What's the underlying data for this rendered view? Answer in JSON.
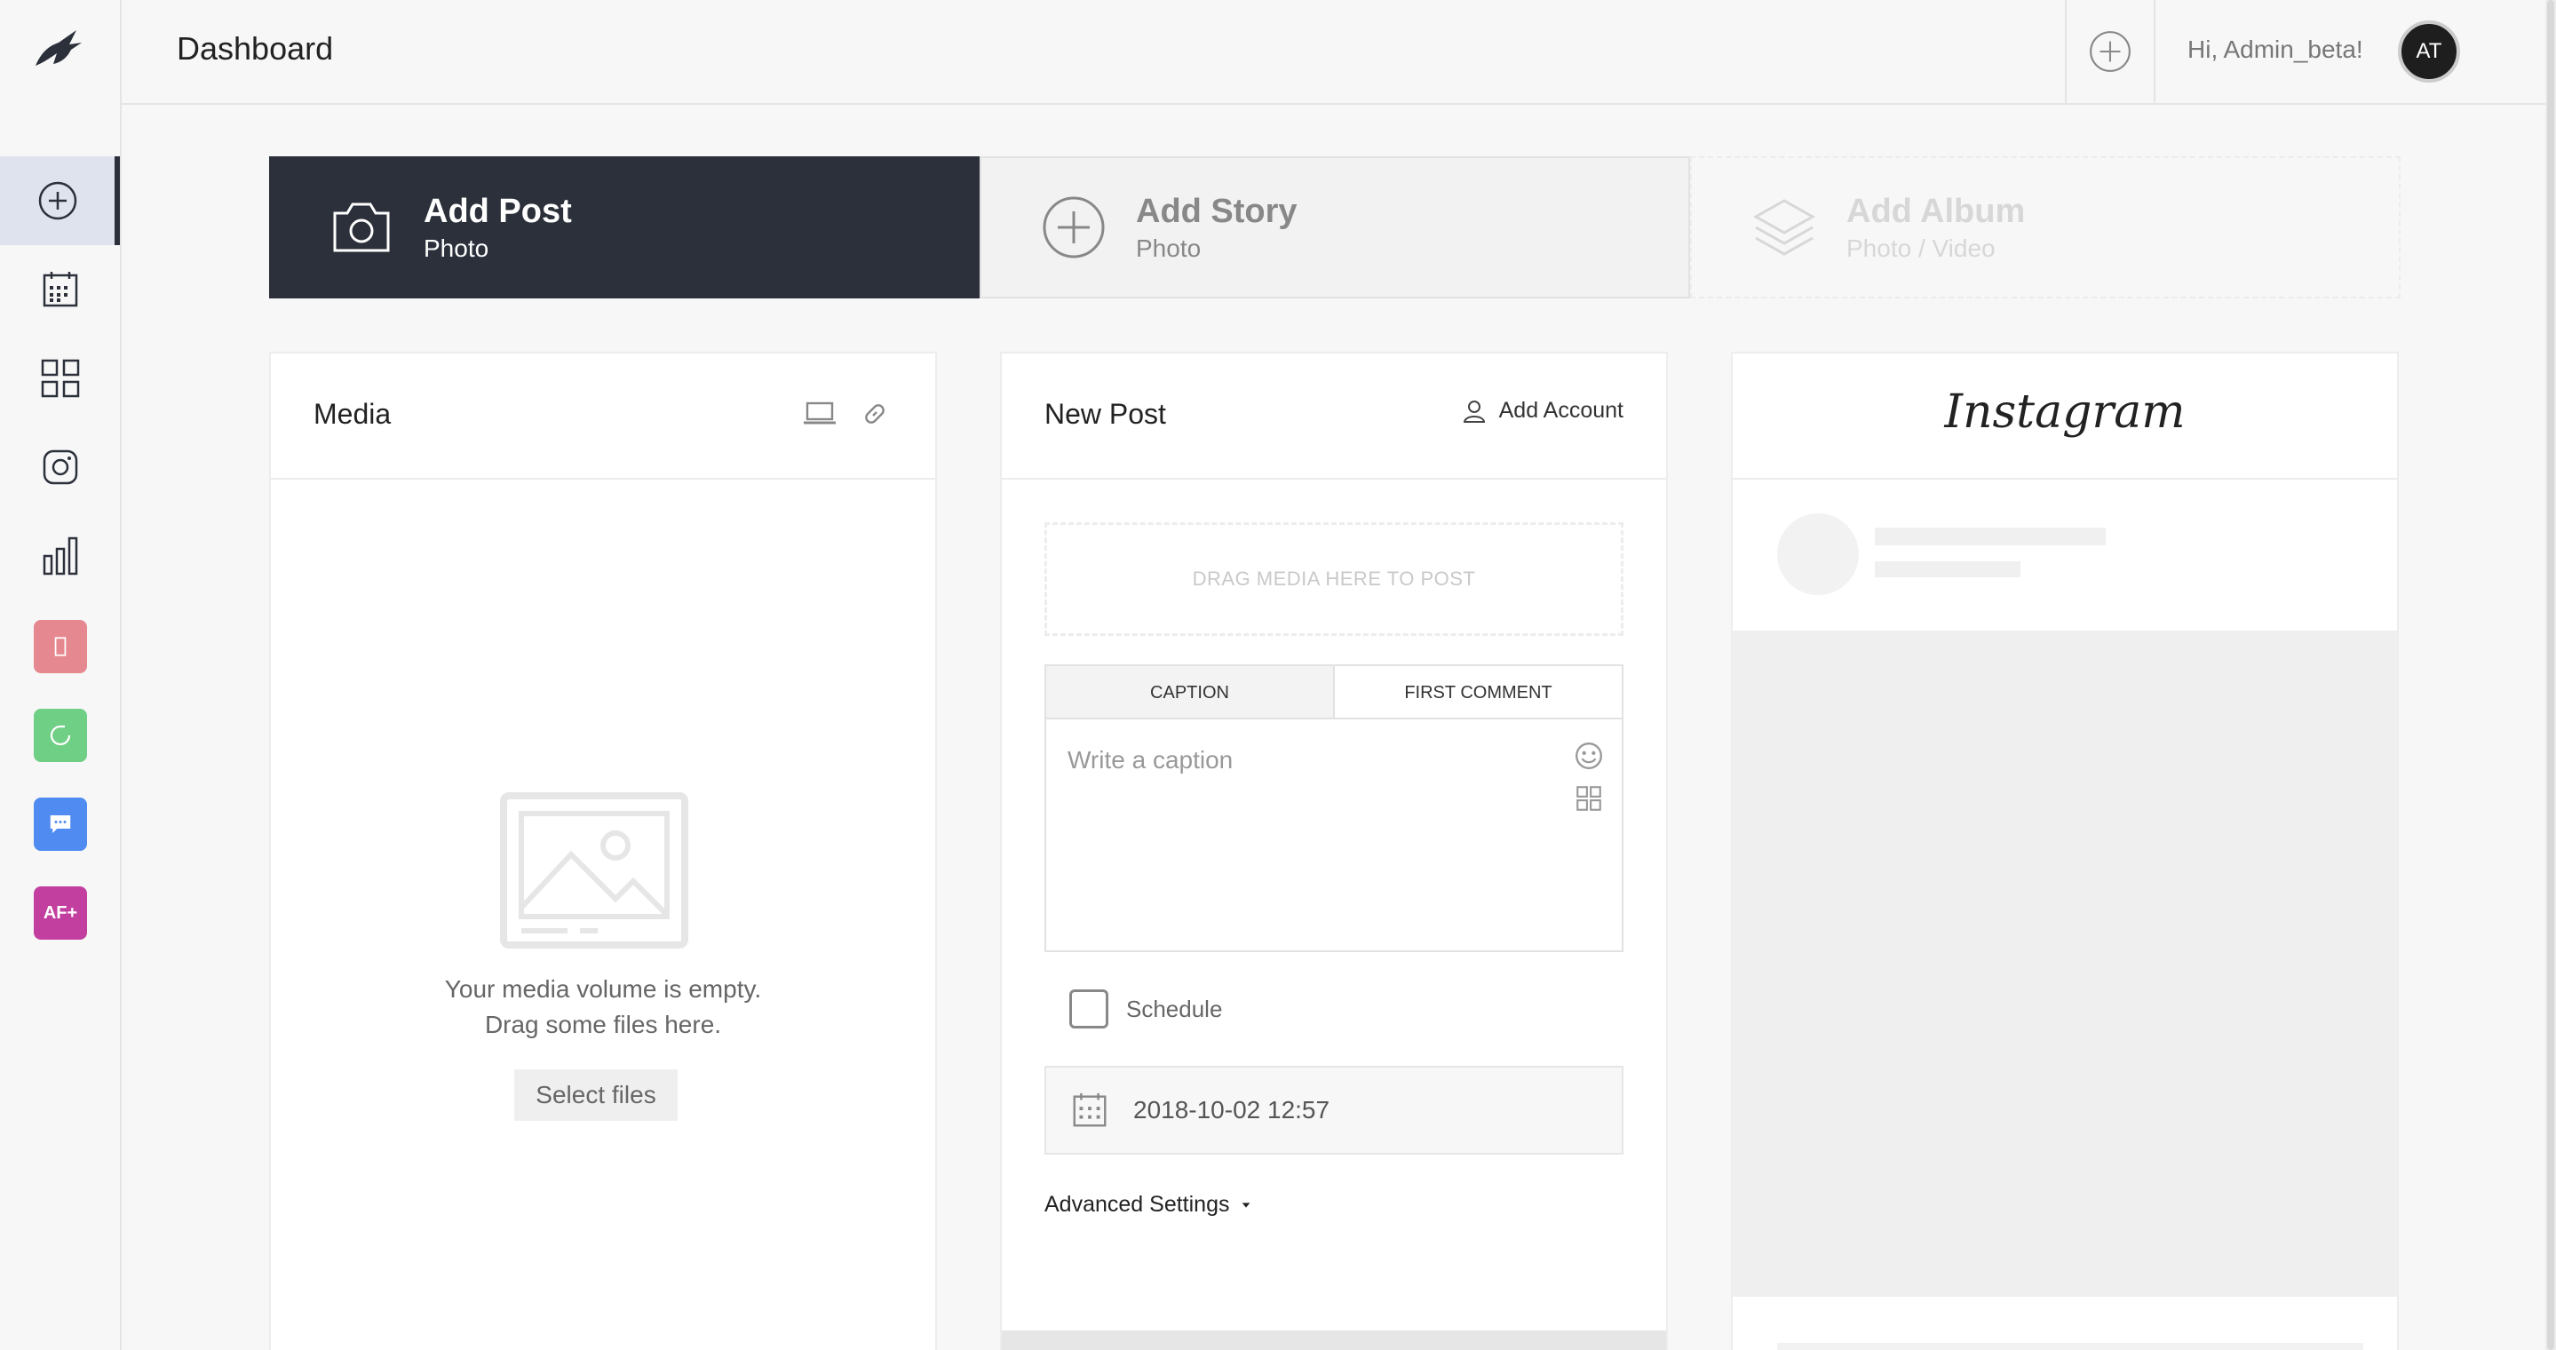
{
  "header": {
    "title": "Dashboard",
    "greeting": "Hi, Admin_beta!",
    "avatar_initials": "AT"
  },
  "sidebar": {
    "items": [
      {
        "name": "add-icon",
        "active": true
      },
      {
        "name": "calendar-icon",
        "active": false
      },
      {
        "name": "grid-icon",
        "active": false
      },
      {
        "name": "instagram-icon",
        "active": false
      },
      {
        "name": "bar-chart-icon",
        "active": false
      }
    ],
    "apps": [
      {
        "name": "app-story",
        "color": "#e6888f",
        "label": ""
      },
      {
        "name": "app-refresh",
        "color": "#6fcf84",
        "label": ""
      },
      {
        "name": "app-chat",
        "color": "#4f8bf0",
        "label": ""
      },
      {
        "name": "app-af",
        "color": "#c23fa0",
        "label": "AF+"
      }
    ]
  },
  "post_types": {
    "post": {
      "title": "Add Post",
      "subtitle": "Photo"
    },
    "story": {
      "title": "Add Story",
      "subtitle": "Photo"
    },
    "album": {
      "title": "Add Album",
      "subtitle": "Photo / Video"
    }
  },
  "media": {
    "title": "Media",
    "empty_line1": "Your media volume is empty.",
    "empty_line2": "Drag some files here.",
    "select_label": "Select files"
  },
  "new_post": {
    "title": "New Post",
    "add_account": "Add Account",
    "dropzone": "DRAG MEDIA HERE TO POST",
    "tabs": [
      "CAPTION",
      "FIRST COMMENT"
    ],
    "caption_placeholder": "Write a caption",
    "schedule_label": "Schedule",
    "date_value": "2018-10-02 12:57",
    "advanced": "Advanced Settings"
  },
  "preview": {
    "logo": "Instagram"
  },
  "colors": {
    "dark": "#2b303a",
    "active_nav": "#dfe3ee"
  }
}
